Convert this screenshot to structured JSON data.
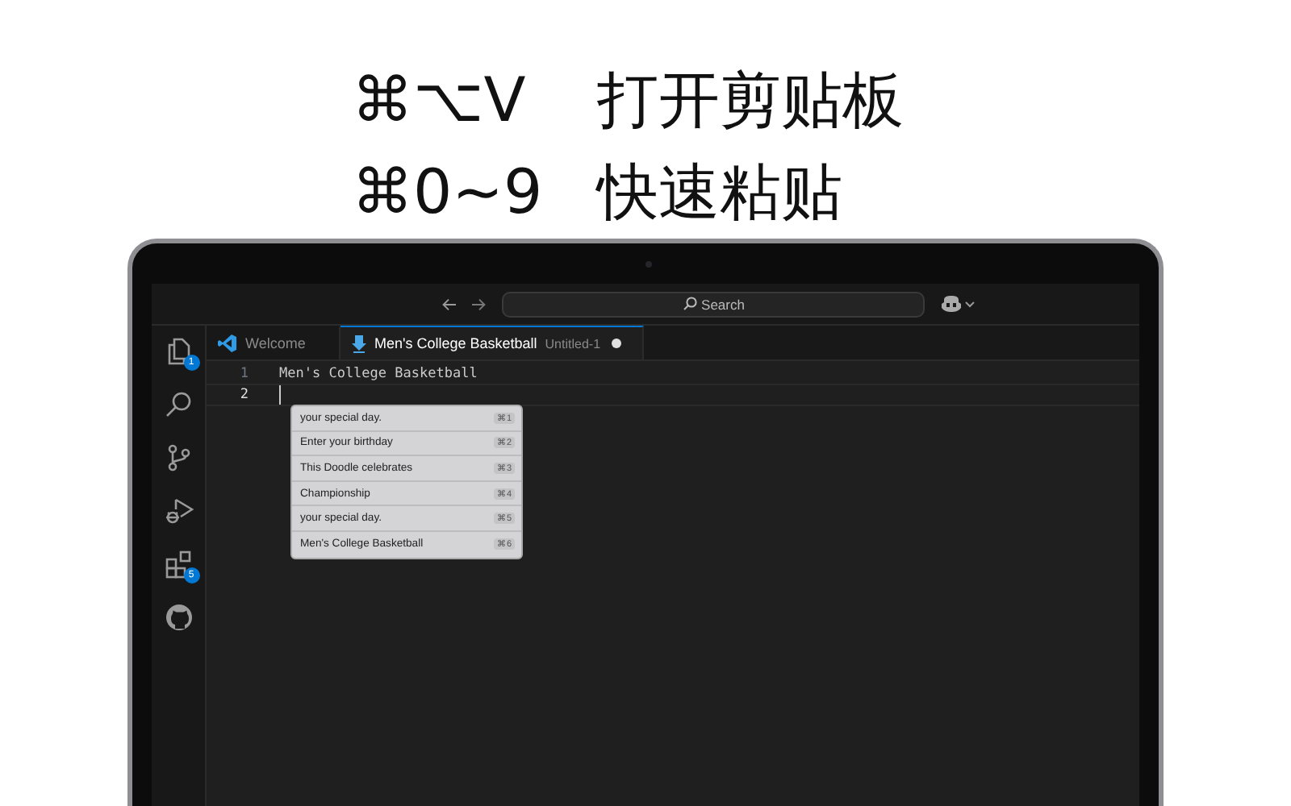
{
  "headline": [
    {
      "keys": "⌘⌥V",
      "action": "打开剪贴板"
    },
    {
      "keys": "⌘0~9",
      "action": "快速粘贴"
    }
  ],
  "ide": {
    "search": {
      "placeholder": "Search"
    },
    "activity_bar": [
      {
        "kind": "files",
        "badge": "1"
      },
      {
        "kind": "search"
      },
      {
        "kind": "source-control"
      },
      {
        "kind": "run-debug"
      },
      {
        "kind": "extensions",
        "badge": "5"
      },
      {
        "kind": "github"
      }
    ],
    "tabs": [
      {
        "kind": "welcome",
        "label": "Welcome",
        "selected": false,
        "modified": false
      },
      {
        "kind": "file",
        "label": "Men's College Basketball",
        "description": "Untitled-1",
        "selected": true,
        "modified": true
      }
    ],
    "editor": {
      "lines": [
        {
          "number": "1",
          "text": "Men's College Basketball",
          "current": false
        },
        {
          "number": "2",
          "current": true
        }
      ]
    },
    "clipboard_menu": [
      {
        "text": "your special day.",
        "shortcut": "⌘1"
      },
      {
        "text": "Enter your birthday",
        "shortcut": "⌘2"
      },
      {
        "text": "This Doodle celebrates",
        "shortcut": "⌘3"
      },
      {
        "text": "Championship",
        "shortcut": "⌘4"
      },
      {
        "text": "your special day.",
        "shortcut": "⌘5"
      },
      {
        "text": "Men's College Basketball",
        "shortcut": "⌘6"
      }
    ]
  }
}
